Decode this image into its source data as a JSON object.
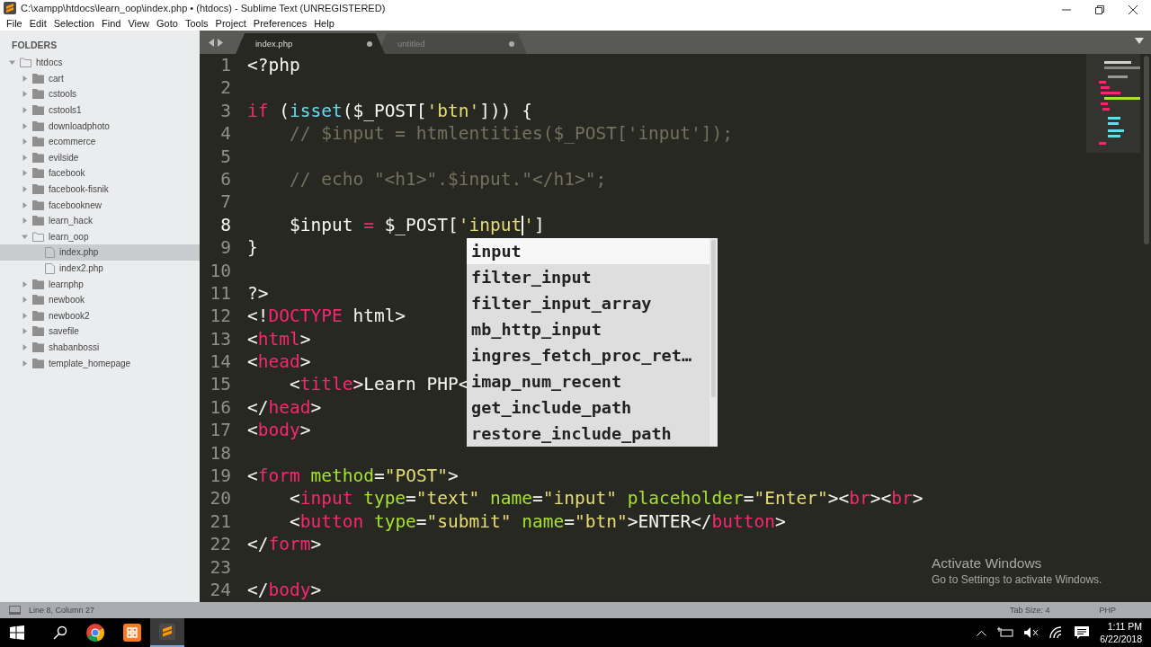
{
  "window": {
    "title": "C:\\xampp\\htdocs\\learn_oop\\index.php • (htdocs) - Sublime Text (UNREGISTERED)"
  },
  "menu": [
    "File",
    "Edit",
    "Selection",
    "Find",
    "View",
    "Goto",
    "Tools",
    "Project",
    "Preferences",
    "Help"
  ],
  "sidebar": {
    "heading": "FOLDERS",
    "items": [
      {
        "label": "htdocs",
        "kind": "folder",
        "expanded": true,
        "selected": false,
        "children": [
          {
            "label": "cart",
            "kind": "folder",
            "expanded": false,
            "selected": false
          },
          {
            "label": "cstools",
            "kind": "folder",
            "expanded": false,
            "selected": false
          },
          {
            "label": "cstools1",
            "kind": "folder",
            "expanded": false,
            "selected": false
          },
          {
            "label": "downloadphoto",
            "kind": "folder",
            "expanded": false,
            "selected": false
          },
          {
            "label": "ecommerce",
            "kind": "folder",
            "expanded": false,
            "selected": false
          },
          {
            "label": "evilside",
            "kind": "folder",
            "expanded": false,
            "selected": false
          },
          {
            "label": "facebook",
            "kind": "folder",
            "expanded": false,
            "selected": false
          },
          {
            "label": "facebook-fisnik",
            "kind": "folder",
            "expanded": false,
            "selected": false
          },
          {
            "label": "facebooknew",
            "kind": "folder",
            "expanded": false,
            "selected": false
          },
          {
            "label": "learn_hack",
            "kind": "folder",
            "expanded": false,
            "selected": false
          },
          {
            "label": "learn_oop",
            "kind": "folder",
            "expanded": true,
            "selected": false,
            "children": [
              {
                "label": "index.php",
                "kind": "file",
                "selected": true
              },
              {
                "label": "index2.php",
                "kind": "file",
                "selected": false
              }
            ]
          },
          {
            "label": "learnphp",
            "kind": "folder",
            "expanded": false,
            "selected": false
          },
          {
            "label": "newbook",
            "kind": "folder",
            "expanded": false,
            "selected": false
          },
          {
            "label": "newbook2",
            "kind": "folder",
            "expanded": false,
            "selected": false
          },
          {
            "label": "savefile",
            "kind": "folder",
            "expanded": false,
            "selected": false
          },
          {
            "label": "shabanbossi",
            "kind": "folder",
            "expanded": false,
            "selected": false
          },
          {
            "label": "template_homepage",
            "kind": "folder",
            "expanded": false,
            "selected": false
          }
        ]
      }
    ]
  },
  "tabs": [
    {
      "label": "index.php",
      "selected": true,
      "modified": true
    },
    {
      "label": "untitled",
      "selected": false,
      "modified": true
    }
  ],
  "editor": {
    "lines": [
      {
        "number": "1",
        "tokens": [
          {
            "kind": "plain",
            "text": "<?php"
          }
        ]
      },
      {
        "number": "2"
      },
      {
        "number": "3",
        "tokens": [
          {
            "kind": "keyword",
            "text": "if"
          },
          {
            "kind": "plain",
            "text": " ("
          },
          {
            "kind": "function",
            "text": "isset"
          },
          {
            "kind": "plain",
            "text": "($_POST["
          },
          {
            "kind": "string",
            "text": "'btn'"
          },
          {
            "kind": "plain",
            "text": "])) {"
          }
        ]
      },
      {
        "number": "4",
        "tokens": [
          {
            "kind": "comment",
            "text": "    // $input = htmlentities($_POST['input']);"
          }
        ]
      },
      {
        "number": "5"
      },
      {
        "number": "6",
        "tokens": [
          {
            "kind": "comment",
            "text": "    // echo \"<h1>\".$input.\"</h1>\";"
          }
        ]
      },
      {
        "number": "7"
      },
      {
        "number": "8",
        "current": true,
        "tokens": [
          {
            "kind": "plain",
            "text": "    $input "
          },
          {
            "kind": "keyword",
            "text": "="
          },
          {
            "kind": "plain",
            "text": " $_POST["
          },
          {
            "kind": "string",
            "text": "'input"
          },
          {
            "kind": "cursor"
          },
          {
            "kind": "string",
            "text": "'"
          },
          {
            "kind": "plain",
            "text": "]"
          }
        ]
      },
      {
        "number": "9",
        "tokens": [
          {
            "kind": "plain",
            "text": "}"
          }
        ]
      },
      {
        "number": "10"
      },
      {
        "number": "11",
        "tokens": [
          {
            "kind": "plain",
            "text": "?>"
          }
        ]
      },
      {
        "number": "12",
        "tokens": [
          {
            "kind": "plain",
            "text": "<!"
          },
          {
            "kind": "keyword",
            "text": "DOCTYPE"
          },
          {
            "kind": "plain",
            "text": " html>"
          }
        ]
      },
      {
        "number": "13",
        "tokens": [
          {
            "kind": "plain",
            "text": "<"
          },
          {
            "kind": "keyword",
            "text": "html"
          },
          {
            "kind": "plain",
            "text": ">"
          }
        ]
      },
      {
        "number": "14",
        "tokens": [
          {
            "kind": "plain",
            "text": "<"
          },
          {
            "kind": "keyword",
            "text": "head"
          },
          {
            "kind": "plain",
            "text": ">"
          }
        ]
      },
      {
        "number": "15",
        "tokens": [
          {
            "kind": "plain",
            "text": "    <"
          },
          {
            "kind": "keyword",
            "text": "title"
          },
          {
            "kind": "plain",
            "text": ">Learn PHP<"
          }
        ]
      },
      {
        "number": "16",
        "tokens": [
          {
            "kind": "plain",
            "text": "</"
          },
          {
            "kind": "keyword",
            "text": "head"
          },
          {
            "kind": "plain",
            "text": ">"
          }
        ]
      },
      {
        "number": "17",
        "tokens": [
          {
            "kind": "plain",
            "text": "<"
          },
          {
            "kind": "keyword",
            "text": "body"
          },
          {
            "kind": "plain",
            "text": ">"
          }
        ]
      },
      {
        "number": "18"
      },
      {
        "number": "19",
        "tokens": [
          {
            "kind": "plain",
            "text": "<"
          },
          {
            "kind": "keyword",
            "text": "form"
          },
          {
            "kind": "attribute",
            "text": " method"
          },
          {
            "kind": "plain",
            "text": "="
          },
          {
            "kind": "string",
            "text": "\"POST\""
          },
          {
            "kind": "plain",
            "text": ">"
          }
        ]
      },
      {
        "number": "20",
        "tokens": [
          {
            "kind": "plain",
            "text": "    <"
          },
          {
            "kind": "keyword",
            "text": "input"
          },
          {
            "kind": "attribute",
            "text": " type"
          },
          {
            "kind": "plain",
            "text": "="
          },
          {
            "kind": "string",
            "text": "\"text\""
          },
          {
            "kind": "attribute",
            "text": " name"
          },
          {
            "kind": "plain",
            "text": "="
          },
          {
            "kind": "string",
            "text": "\"input\""
          },
          {
            "kind": "attribute",
            "text": " placeholder"
          },
          {
            "kind": "plain",
            "text": "="
          },
          {
            "kind": "string",
            "text": "\"Enter\""
          },
          {
            "kind": "plain",
            "text": "><"
          },
          {
            "kind": "keyword",
            "text": "br"
          },
          {
            "kind": "plain",
            "text": "><"
          },
          {
            "kind": "keyword",
            "text": "br"
          },
          {
            "kind": "plain",
            "text": ">"
          }
        ]
      },
      {
        "number": "21",
        "tokens": [
          {
            "kind": "plain",
            "text": "    <"
          },
          {
            "kind": "keyword",
            "text": "button"
          },
          {
            "kind": "attribute",
            "text": " type"
          },
          {
            "kind": "plain",
            "text": "="
          },
          {
            "kind": "string",
            "text": "\"submit\""
          },
          {
            "kind": "attribute",
            "text": " name"
          },
          {
            "kind": "plain",
            "text": "="
          },
          {
            "kind": "string",
            "text": "\"btn\""
          },
          {
            "kind": "plain",
            "text": ">ENTER</"
          },
          {
            "kind": "keyword",
            "text": "button"
          },
          {
            "kind": "plain",
            "text": ">"
          }
        ]
      },
      {
        "number": "22",
        "tokens": [
          {
            "kind": "plain",
            "text": "</"
          },
          {
            "kind": "keyword",
            "text": "form"
          },
          {
            "kind": "plain",
            "text": ">"
          }
        ]
      },
      {
        "number": "23"
      },
      {
        "number": "24",
        "tokens": [
          {
            "kind": "plain",
            "text": "</"
          },
          {
            "kind": "keyword",
            "text": "body"
          },
          {
            "kind": "plain",
            "text": ">"
          }
        ]
      }
    ],
    "autocomplete": [
      {
        "label": "input",
        "selected": true
      },
      {
        "label": "filter_input",
        "selected": false
      },
      {
        "label": "filter_input_array",
        "selected": false
      },
      {
        "label": "mb_http_input",
        "selected": false
      },
      {
        "label": "ingres_fetch_proc_ret…",
        "selected": false
      },
      {
        "label": "imap_num_recent",
        "selected": false
      },
      {
        "label": "get_include_path",
        "selected": false
      },
      {
        "label": "restore_include_path",
        "selected": false
      }
    ]
  },
  "activation_notice": {
    "title": "Activate Windows",
    "message": "Go to Settings to activate Windows."
  },
  "status_bar": {
    "position": "Line 8, Column 27",
    "tab_size": "Tab Size: 4",
    "syntax": "PHP"
  },
  "taskbar": {
    "time": "1:11 PM",
    "date": "6/22/2018"
  }
}
